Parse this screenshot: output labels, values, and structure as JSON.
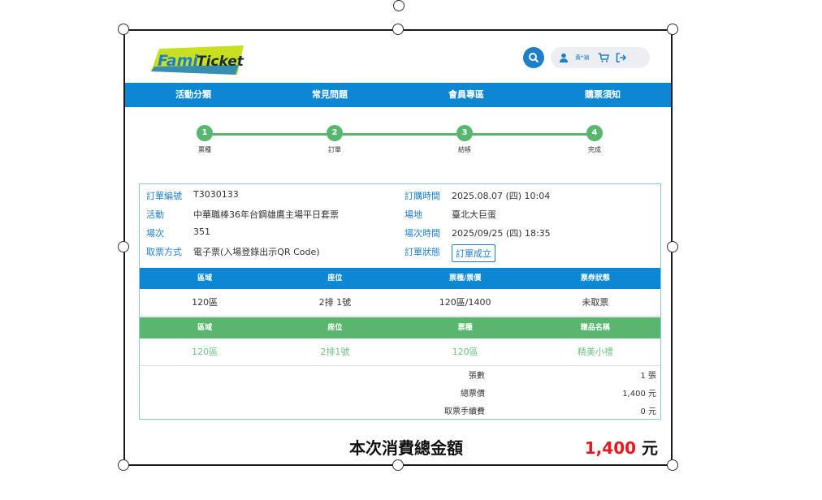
{
  "brand": {
    "logo_text_fami": "Fami",
    "logo_text_ticket": "Ticket"
  },
  "header": {
    "user_name": "黃*禎"
  },
  "nav": {
    "items": [
      "活動分類",
      "常見問題",
      "會員專區",
      "購票須知"
    ]
  },
  "steps": [
    {
      "num": "1",
      "label": "票種"
    },
    {
      "num": "2",
      "label": "訂單"
    },
    {
      "num": "3",
      "label": "結帳"
    },
    {
      "num": "4",
      "label": "完成"
    }
  ],
  "order": {
    "left": [
      {
        "key": "訂單編號",
        "value": "T3030133"
      },
      {
        "key": "活動",
        "value": "中華職棒36年台鋼雄鷹主場平日套票"
      },
      {
        "key": "場次",
        "value": "351"
      },
      {
        "key": "取票方式",
        "value": "電子票(入場登錄出示QR Code)"
      }
    ],
    "right": [
      {
        "key": "訂購時間",
        "value": "2025.08.07 (四) 10:04"
      },
      {
        "key": "場地",
        "value": "臺北大巨蛋"
      },
      {
        "key": "場次時間",
        "value": "2025/09/25 (四) 18:35"
      },
      {
        "key": "訂單狀態",
        "value": ""
      }
    ],
    "status_badge": "訂單成立"
  },
  "ticket_table": {
    "headers": [
      "區域",
      "座位",
      "票種/票價",
      "票券狀態"
    ],
    "row": [
      "120區",
      "2排 1號",
      "120區/1400",
      "未取票"
    ]
  },
  "gift_table": {
    "headers": [
      "區域",
      "座位",
      "票種",
      "贈品名稱"
    ],
    "row": [
      "120區",
      "2排1號",
      "120區",
      "精美小禮"
    ]
  },
  "summary": [
    {
      "label": "張數",
      "value": "1 張"
    },
    {
      "label": "總票價",
      "value": "1,400 元"
    },
    {
      "label": "取票手續費",
      "value": "0 元"
    }
  ],
  "total": {
    "label": "本次消費總金額",
    "amount": "1,400",
    "unit": "元"
  },
  "colors": {
    "primary_blue": "#0b87d3",
    "step_green": "#58b66e",
    "total_red": "#e8191d"
  }
}
